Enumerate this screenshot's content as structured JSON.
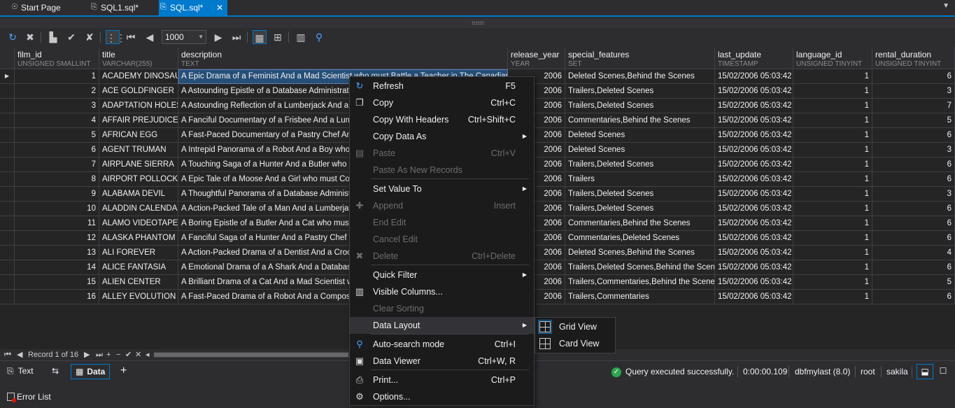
{
  "tabs": [
    {
      "label": "Start Page",
      "icon": "start-page-icon"
    },
    {
      "label": "SQL1.sql*",
      "icon": "sql-file-icon"
    },
    {
      "label": "SQL.sql*",
      "icon": "sql-file-icon",
      "active": true
    }
  ],
  "toolbar": {
    "row_limit": "1000"
  },
  "columns": [
    {
      "name": "film_id",
      "type": "UNSIGNED SMALLINT"
    },
    {
      "name": "title",
      "type": "VARCHAR(255)"
    },
    {
      "name": "description",
      "type": "TEXT"
    },
    {
      "name": "release_year",
      "type": "YEAR"
    },
    {
      "name": "special_features",
      "type": "SET"
    },
    {
      "name": "last_update",
      "type": "TIMESTAMP"
    },
    {
      "name": "language_id",
      "type": "UNSIGNED TINYINT"
    },
    {
      "name": "rental_duration",
      "type": "UNSIGNED TINYINT"
    }
  ],
  "rows": [
    [
      "1",
      "ACADEMY DINOSAUR",
      "A Epic Drama of a Feminist And a Mad Scientist who must Battle a Teacher in The Canadian Ro",
      "2006",
      "Deleted Scenes,Behind the Scenes",
      "15/02/2006 05:03:42",
      "1",
      "6"
    ],
    [
      "2",
      "ACE GOLDFINGER",
      "A Astounding Epistle of a Database Administrator",
      "2006",
      "Trailers,Deleted Scenes",
      "15/02/2006 05:03:42",
      "1",
      "3"
    ],
    [
      "3",
      "ADAPTATION HOLES",
      "A Astounding Reflection of a Lumberjack And a Ca",
      "2006",
      "Trailers,Deleted Scenes",
      "15/02/2006 05:03:42",
      "1",
      "7"
    ],
    [
      "4",
      "AFFAIR PREJUDICE",
      "A Fanciful Documentary of a Frisbee And a Lumbe",
      "2006",
      "Commentaries,Behind the Scenes",
      "15/02/2006 05:03:42",
      "1",
      "5"
    ],
    [
      "5",
      "AFRICAN EGG",
      "A Fast-Paced Documentary of a Pastry Chef And",
      "2006",
      "Deleted Scenes",
      "15/02/2006 05:03:42",
      "1",
      "6"
    ],
    [
      "6",
      "AGENT TRUMAN",
      "A Intrepid Panorama of a Robot And a Boy who m",
      "2006",
      "Deleted Scenes",
      "15/02/2006 05:03:42",
      "1",
      "3"
    ],
    [
      "7",
      "AIRPLANE SIERRA",
      "A Touching Saga of a Hunter And a Butler who mu",
      "2006",
      "Trailers,Deleted Scenes",
      "15/02/2006 05:03:42",
      "1",
      "6"
    ],
    [
      "8",
      "AIRPORT POLLOCK",
      "A Epic Tale of a Moose And a Girl who must Confro",
      "2006",
      "Trailers",
      "15/02/2006 05:03:42",
      "1",
      "6"
    ],
    [
      "9",
      "ALABAMA DEVIL",
      "A Thoughtful Panorama of a Database Administrat",
      "2006",
      "Trailers,Deleted Scenes",
      "15/02/2006 05:03:42",
      "1",
      "3"
    ],
    [
      "10",
      "ALADDIN CALENDAR",
      "A Action-Packed Tale of a Man And a Lumberjack v",
      "2006",
      "Trailers,Deleted Scenes",
      "15/02/2006 05:03:42",
      "1",
      "6"
    ],
    [
      "11",
      "ALAMO VIDEOTAPE",
      "A Boring Epistle of a Butler And a Cat who must Fi",
      "2006",
      "Commentaries,Behind the Scenes",
      "15/02/2006 05:03:42",
      "1",
      "6"
    ],
    [
      "12",
      "ALASKA PHANTOM",
      "A Fanciful Saga of a Hunter And a Pastry Chef wh",
      "2006",
      "Commentaries,Deleted Scenes",
      "15/02/2006 05:03:42",
      "1",
      "6"
    ],
    [
      "13",
      "ALI FOREVER",
      "A Action-Packed Drama of a Dentist And a Crocod",
      "2006",
      "Deleted Scenes,Behind the Scenes",
      "15/02/2006 05:03:42",
      "1",
      "4"
    ],
    [
      "14",
      "ALICE FANTASIA",
      "A Emotional Drama of a A Shark And a Database A",
      "2006",
      "Trailers,Deleted Scenes,Behind the Scenes",
      "15/02/2006 05:03:42",
      "1",
      "6"
    ],
    [
      "15",
      "ALIEN CENTER",
      "A Brilliant Drama of a Cat And a Mad Scientist who",
      "2006",
      "Trailers,Commentaries,Behind the Scenes",
      "15/02/2006 05:03:42",
      "1",
      "5"
    ],
    [
      "16",
      "ALLEY EVOLUTION",
      "A Fast-Paced Drama of a Robot And a Composer v",
      "2006",
      "Trailers,Commentaries",
      "15/02/2006 05:03:42",
      "1",
      "6"
    ]
  ],
  "navigator": {
    "record_text": "Record 1 of 16"
  },
  "bottom": {
    "text_tab": "Text",
    "data_tab": "Data",
    "add": "+",
    "status_message": "Query executed successfully.",
    "elapsed": "0:00:00.109",
    "connection": "dbfmylast (8.0)",
    "user": "root",
    "database": "sakila"
  },
  "error_list": "Error List",
  "context_menu": [
    {
      "label": "Refresh",
      "shortcut": "F5",
      "icon": "refresh-icon",
      "enabled": true
    },
    {
      "label": "Copy",
      "shortcut": "Ctrl+C",
      "icon": "copy-icon",
      "enabled": true
    },
    {
      "label": "Copy With Headers",
      "shortcut": "Ctrl+Shift+C",
      "enabled": true
    },
    {
      "label": "Copy Data As",
      "submenu": true,
      "enabled": true
    },
    {
      "label": "Paste",
      "shortcut": "Ctrl+V",
      "icon": "paste-icon",
      "enabled": false
    },
    {
      "label": "Paste As New Records",
      "enabled": false
    },
    {
      "label": "Set Value To",
      "submenu": true,
      "enabled": true
    },
    {
      "label": "Append",
      "shortcut": "Insert",
      "icon": "append-icon",
      "enabled": false
    },
    {
      "label": "End Edit",
      "enabled": false
    },
    {
      "label": "Cancel Edit",
      "enabled": false
    },
    {
      "label": "Delete",
      "shortcut": "Ctrl+Delete",
      "icon": "delete-icon",
      "enabled": false
    },
    {
      "label": "Quick Filter",
      "submenu": true,
      "enabled": true
    },
    {
      "label": "Visible Columns...",
      "icon": "columns-icon",
      "enabled": true
    },
    {
      "label": "Clear Sorting",
      "enabled": false
    },
    {
      "label": "Data Layout",
      "submenu": true,
      "enabled": true,
      "highlighted": true
    },
    {
      "label": "Auto-search mode",
      "shortcut": "Ctrl+I",
      "icon": "auto-search-icon",
      "enabled": true
    },
    {
      "label": "Data Viewer",
      "shortcut": "Ctrl+W, R",
      "icon": "data-viewer-icon",
      "enabled": true
    },
    {
      "label": "Print...",
      "shortcut": "Ctrl+P",
      "icon": "print-icon",
      "enabled": true
    },
    {
      "label": "Options...",
      "icon": "options-icon",
      "enabled": true
    }
  ],
  "data_layout_submenu": [
    {
      "label": "Grid View",
      "icon": "grid-view-icon",
      "checked": true
    },
    {
      "label": "Card View",
      "icon": "card-view-icon",
      "checked": false
    }
  ]
}
